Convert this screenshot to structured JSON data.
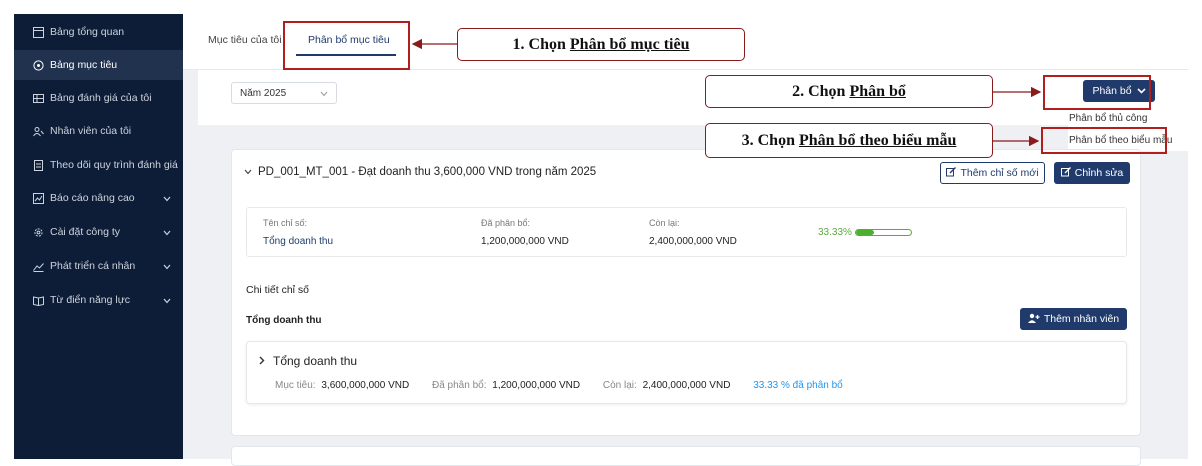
{
  "sidebar": {
    "items": [
      {
        "label": "Bảng tổng quan",
        "icon": "dashboard-icon",
        "active": false,
        "expandable": false
      },
      {
        "label": "Bảng mục tiêu",
        "icon": "target-icon",
        "active": true,
        "expandable": false
      },
      {
        "label": "Bảng đánh giá của tôi",
        "icon": "table-icon",
        "active": false,
        "expandable": false
      },
      {
        "label": "Nhân viên của tôi",
        "icon": "users-icon",
        "active": false,
        "expandable": false
      },
      {
        "label": "Theo dõi quy trình đánh giá",
        "icon": "clipboard-icon",
        "active": false,
        "expandable": false
      },
      {
        "label": "Báo cáo nâng cao",
        "icon": "chart-icon",
        "active": false,
        "expandable": true
      },
      {
        "label": "Cài đặt công ty",
        "icon": "gear-icon",
        "active": false,
        "expandable": true
      },
      {
        "label": "Phát triển cá nhân",
        "icon": "growth-icon",
        "active": false,
        "expandable": true
      },
      {
        "label": "Từ điển năng lực",
        "icon": "book-icon",
        "active": false,
        "expandable": true
      }
    ]
  },
  "tabs": {
    "my_goals": "Mục tiêu của tôi",
    "allocate_goals": "Phân bổ mục tiêu"
  },
  "filter": {
    "year": "Năm 2025"
  },
  "allocate_button": {
    "label": "Phân bổ"
  },
  "allocate_menu": {
    "items": [
      "Phân bổ thủ công",
      "Phân bổ theo biểu mẫu"
    ]
  },
  "card": {
    "title": "PD_001_MT_001 - Đạt doanh thu 3,600,000 VND trong năm 2025",
    "add_indicator_label": "Thêm chỉ số mới",
    "edit_label": "Chỉnh sửa",
    "summary": {
      "indicator_name_label": "Tên chỉ số:",
      "indicator_name_value": "Tổng doanh thu",
      "allocated_label": "Đã phân bổ:",
      "allocated_value": "1,200,000,000 VND",
      "remaining_label": "Còn lại:",
      "remaining_value": "2,400,000,000 VND",
      "progress_text": "33.33%",
      "progress": 0.3333
    },
    "detail_title": "Chi tiết chỉ số",
    "detail_subtitle": "Tổng doanh thu",
    "add_employee_label": "Thêm nhân viên",
    "indicator": {
      "name": "Tổng doanh thu",
      "target_label": "Mục tiêu:",
      "target_value": "3,600,000,000 VND",
      "allocated_label": "Đã phân bổ:",
      "allocated_value": "1,200,000,000 VND",
      "remaining_label": "Còn lại:",
      "remaining_value": "2,400,000,000 VND",
      "allocated_pct_text": "33.33 % đã phân bổ"
    }
  },
  "callouts": {
    "step1_prefix": "1. Chọn ",
    "step1_target": "Phân bổ mục tiêu",
    "step2_prefix": "2. Chọn ",
    "step2_target": "Phân bổ",
    "step3_prefix": "3. Chọn ",
    "step3_target": "Phân bổ theo biểu mẫu"
  },
  "colors": {
    "sidebar_bg": "#0e1d37",
    "primary": "#1f3a6b",
    "highlight": "#b01e1e",
    "progress": "#4caf2e",
    "link_blue": "#2196f3"
  }
}
